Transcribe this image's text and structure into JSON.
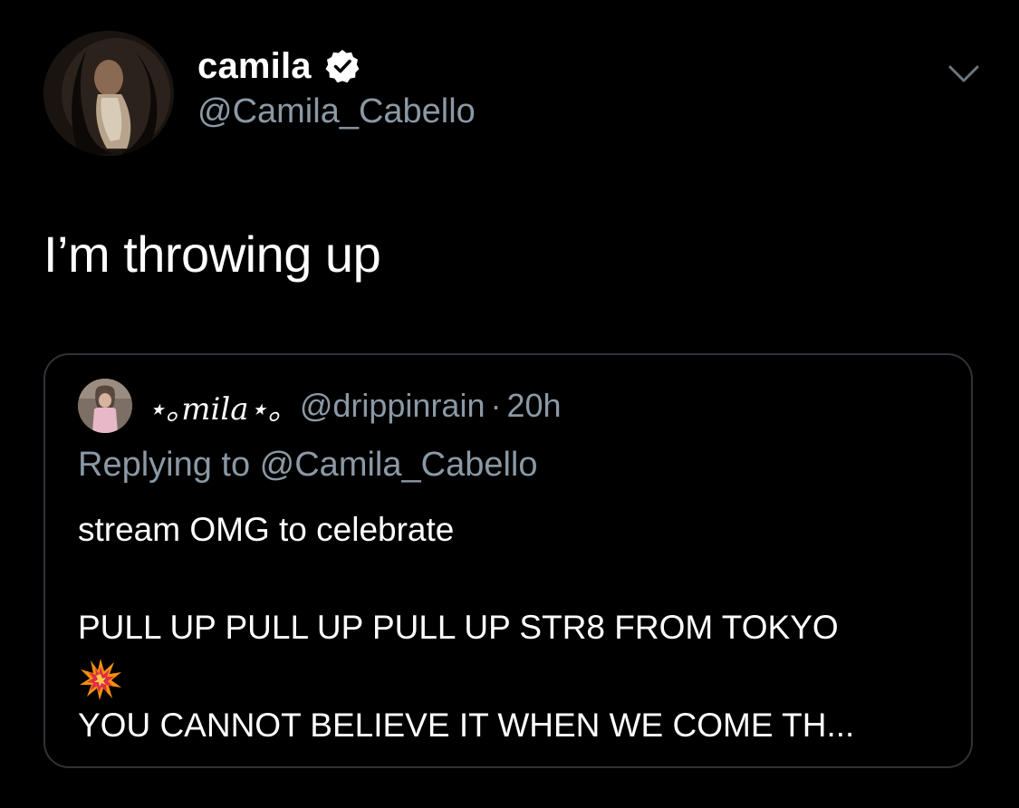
{
  "author": {
    "display_name": "camila",
    "handle": "@Camila_Cabello",
    "verified_icon": "verified-badge-icon",
    "avatar_icon": "user-avatar"
  },
  "menu_icon": "chevron-down-icon",
  "tweet": {
    "text": "I’m throwing up"
  },
  "quoted_tweet": {
    "display_name": "⋆｡𝑚𝑖𝑙𝑎⋆｡",
    "handle": "@drippinrain",
    "separator": "·",
    "time": "20h",
    "replying_to": "Replying to @Camila_Cabello",
    "line_1": "stream OMG to celebrate",
    "line_2": "PULL UP PULL UP PULL UP STR8 FROM TOKYO",
    "emoji_icon": "collision-icon",
    "line_3": "YOU CANNOT BELIEVE IT WHEN WE COME TH..."
  },
  "colors": {
    "background": "#000000",
    "primary_text": "#ffffff",
    "secondary_text": "#8b98a5",
    "card_border": "#2f3336"
  }
}
